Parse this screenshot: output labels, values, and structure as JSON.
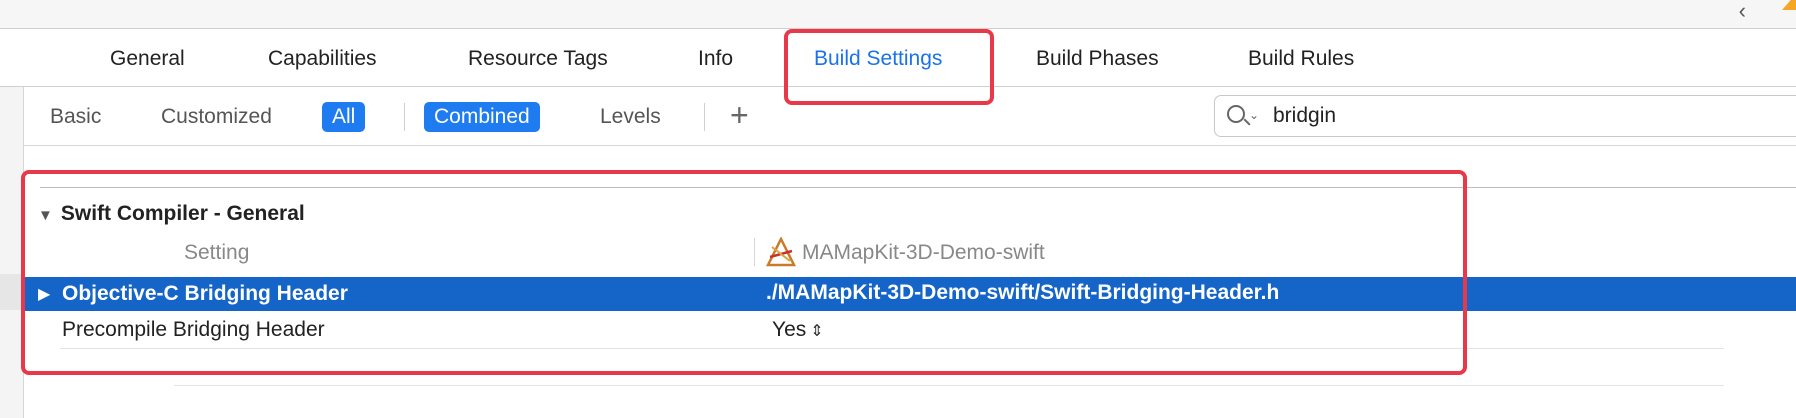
{
  "tabs": [
    {
      "label": "General"
    },
    {
      "label": "Capabilities"
    },
    {
      "label": "Resource Tags"
    },
    {
      "label": "Info"
    },
    {
      "label": "Build Settings",
      "active": true
    },
    {
      "label": "Build Phases"
    },
    {
      "label": "Build Rules"
    }
  ],
  "filters": {
    "basic": "Basic",
    "customized": "Customized",
    "all": "All",
    "combined": "Combined",
    "levels": "Levels",
    "add": "+"
  },
  "search": {
    "value": "bridgin",
    "icon": "search-icon"
  },
  "section": {
    "title": "Swift Compiler - General"
  },
  "columns": {
    "setting": "Setting",
    "target": "MAMapKit-3D-Demo-swift",
    "target_icon": "xcode-app-icon"
  },
  "rows": [
    {
      "name": "Objective-C Bridging Header",
      "value": "./MAMapKit-3D-Demo-swift/Swift-Bridging-Header.h",
      "selected": true
    },
    {
      "name": "Precompile Bridging Header",
      "value": "Yes"
    }
  ],
  "colors": {
    "accent": "#1a73e8",
    "selection": "#1565c8",
    "highlight": "#e8394a"
  }
}
